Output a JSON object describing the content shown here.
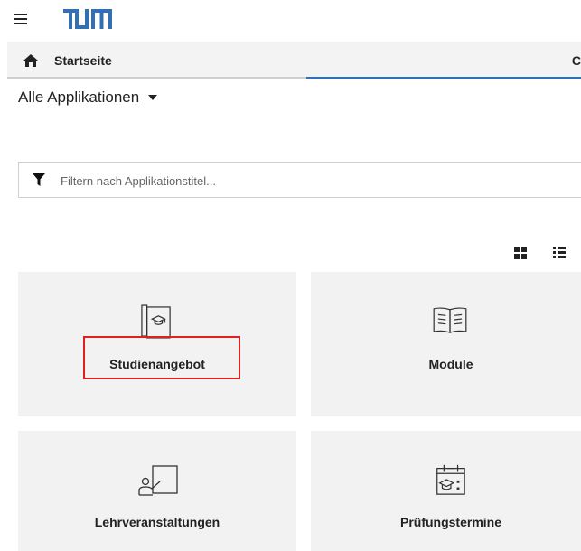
{
  "header": {
    "menu_icon": "hamburger-icon",
    "logo_icon": "tum-logo"
  },
  "navbar": {
    "home_icon": "home-icon",
    "home_label": "Startseite",
    "right_fragment": "C",
    "colors": {
      "inactive": "#cfcfcf",
      "active": "#3070b3"
    }
  },
  "apps_dropdown": {
    "label": "Alle Applikationen"
  },
  "filter": {
    "icon": "filter-icon",
    "placeholder": "Filtern nach Applikationstitel...",
    "value": ""
  },
  "view_toggle": {
    "grid_icon": "grid-view-icon",
    "list_icon": "list-view-icon"
  },
  "tiles": [
    {
      "label": "Studienangebot",
      "icon": "book-graduation-icon"
    },
    {
      "label": "Module",
      "icon": "open-book-icon"
    },
    {
      "label": "Lehrveranstaltungen",
      "icon": "lecturer-board-icon"
    },
    {
      "label": "Prüfungstermine",
      "icon": "exam-calendar-icon"
    }
  ],
  "highlight_color": "#e02020"
}
